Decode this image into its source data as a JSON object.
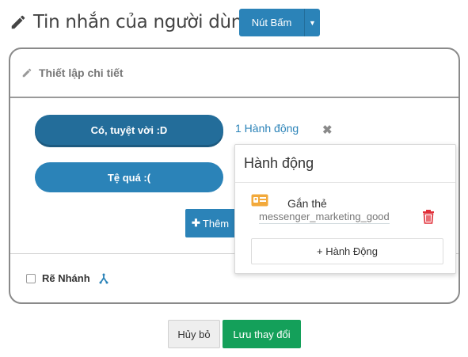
{
  "header": {
    "title": "Tin nhắn của người dùng",
    "button_label": "Nút Bấm"
  },
  "card": {
    "section_label": "Thiết lập chi tiết",
    "replies": [
      {
        "label": "Có, tuyệt vời :D",
        "selected": true
      },
      {
        "label": "Tệ quá :(",
        "selected": false
      }
    ],
    "action_link": "1 Hành động",
    "remove_symbol": "✖",
    "add_button_label": "Thêm",
    "branch_label": "Rẽ Nhánh",
    "branch_checked": false
  },
  "popover": {
    "title": "Hành động",
    "action_name": "Gắn thẻ",
    "action_value": "messenger_marketing_good",
    "add_action_label": "+ Hành Động"
  },
  "footer": {
    "cancel_label": "Hủy bỏ",
    "save_label": "Lưu thay đổi"
  },
  "colors": {
    "primary": "#2b83b8",
    "primary_dark": "#236d9a",
    "success": "#14a05a",
    "danger": "#e0303a",
    "tag_icon": "#f2a93b"
  },
  "icons": [
    "pencil-icon",
    "caret-down-icon",
    "close-icon",
    "plus-icon",
    "branch-icon",
    "tag-icon",
    "trash-icon"
  ]
}
